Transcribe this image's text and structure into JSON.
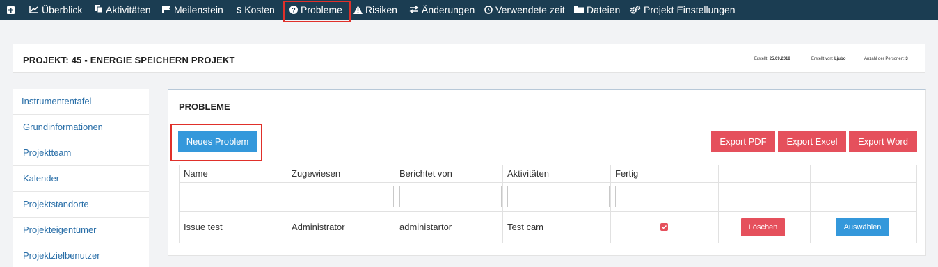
{
  "nav": {
    "items": [
      {
        "icon": "plus-square-icon",
        "glyph": "⊞",
        "label": ""
      },
      {
        "icon": "line-chart-icon",
        "glyph": "📈",
        "label": "Überblick"
      },
      {
        "icon": "file-copy-icon",
        "glyph": "❐",
        "label": "Aktivitäten"
      },
      {
        "icon": "flag-icon",
        "glyph": "⚑",
        "label": "Meilenstein"
      },
      {
        "icon": "dollar-icon",
        "glyph": "$",
        "label": "Kosten"
      },
      {
        "icon": "question-circle-icon",
        "glyph": "❓",
        "label": "Probleme"
      },
      {
        "icon": "warning-icon",
        "glyph": "⚠",
        "label": "Risiken"
      },
      {
        "icon": "exchange-icon",
        "glyph": "⇄",
        "label": "Änderungen"
      },
      {
        "icon": "clock-icon",
        "glyph": "◷",
        "label": "Verwendete zeit"
      },
      {
        "icon": "folder-icon",
        "glyph": "▬",
        "label": "Dateien"
      },
      {
        "icon": "cogs-icon",
        "glyph": "⚙",
        "label": "Projekt Einstellungen"
      }
    ],
    "active": "Probleme"
  },
  "project": {
    "title": "PROJEKT: 45 - ENERGIE SPEICHERN PROJEKT",
    "created_label": "Erstellt:",
    "created_value": "25.09.2018",
    "created_by_label": "Erstellt von:",
    "created_by_value": "Ljubo",
    "persons_label": "Anzahl der Personen:",
    "persons_value": "3"
  },
  "sidebar": {
    "items": [
      {
        "label": "Instrumententafel"
      },
      {
        "label": "Grundinformationen"
      },
      {
        "label": "Projektteam"
      },
      {
        "label": "Kalender"
      },
      {
        "label": "Projektstandorte"
      },
      {
        "label": "Projekteigentümer"
      },
      {
        "label": "Projektzielbenutzer"
      }
    ]
  },
  "main": {
    "title": "PROBLEME",
    "new_button": "Neues Problem",
    "export_pdf": "Export PDF",
    "export_excel": "Export Excel",
    "export_word": "Export Word",
    "columns": [
      "Name",
      "Zugewiesen",
      "Berichtet von",
      "Aktivitäten",
      "Fertig",
      "",
      ""
    ],
    "rows": [
      {
        "name": "Issue test",
        "assigned": "Administrator",
        "reported_by": "administartor",
        "activity": "Test cam",
        "done": true,
        "delete_label": "Löschen",
        "select_label": "Auswählen"
      }
    ]
  },
  "colors": {
    "nav_bg": "#1b3d52",
    "primary": "#3498db",
    "danger": "#e5505c",
    "link": "#2a6fa8",
    "highlight": "#e0302a"
  }
}
